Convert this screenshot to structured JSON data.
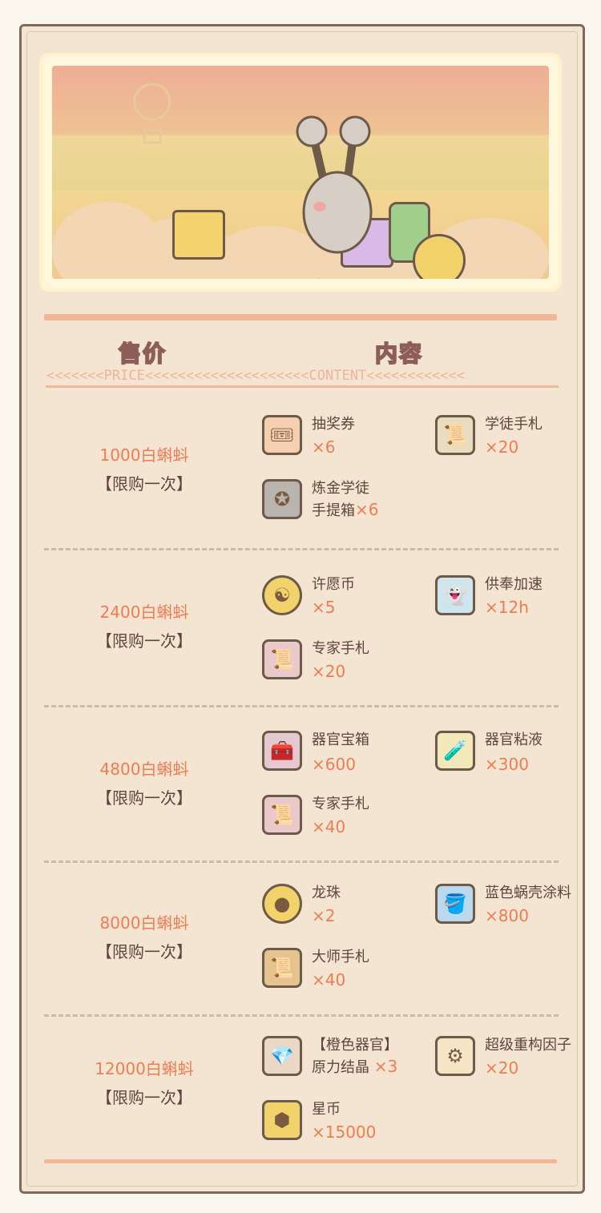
{
  "headers": {
    "price": "售价",
    "content": "内容"
  },
  "divider": {
    "left": "<<<<<<<PRICE",
    "mid": "<<<<<<<<<<<<<<<<<<<<CONTENT",
    "right": "<<<<<<<<<<<<"
  },
  "tiers": [
    {
      "price": "1000白蝌蚪",
      "limit": "【限购一次】",
      "items": [
        {
          "icon": "ticket-icon",
          "name": "抽奖券",
          "qty": "×6"
        },
        {
          "icon": "scroll-icon",
          "name": "学徒手札",
          "qty": "×20"
        },
        {
          "icon": "briefcase-icon",
          "name": "炼金学徒",
          "name2": "手提箱",
          "qty": "×6"
        }
      ]
    },
    {
      "price": "2400白蝌蚪",
      "limit": "【限购一次】",
      "items": [
        {
          "icon": "coin-icon",
          "name": "许愿币",
          "qty": "×5"
        },
        {
          "icon": "ghost-icon",
          "name": "供奉加速",
          "qty": "×12h"
        },
        {
          "icon": "expert-scroll-icon",
          "name": "专家手札",
          "qty": "×20"
        }
      ]
    },
    {
      "price": "4800白蝌蚪",
      "limit": "【限购一次】",
      "items": [
        {
          "icon": "chest-icon",
          "name": "器官宝箱",
          "qty": "×600"
        },
        {
          "icon": "vial-icon",
          "name": "器官粘液",
          "qty": "×300"
        },
        {
          "icon": "expert-scroll-icon",
          "name": "专家手札",
          "qty": "×40"
        }
      ]
    },
    {
      "price": "8000白蝌蚪",
      "limit": "【限购一次】",
      "items": [
        {
          "icon": "dragon-pearl-icon",
          "name": "龙珠",
          "qty": "×2"
        },
        {
          "icon": "paint-bucket-icon",
          "name": "蓝色蜗壳涂料",
          "qty": "×800"
        },
        {
          "icon": "master-scroll-icon",
          "name": "大师手札",
          "qty": "×40"
        }
      ]
    },
    {
      "price": "12000白蝌蚪",
      "limit": "【限购一次】",
      "items": [
        {
          "icon": "crystal-icon",
          "name": "【橙色器官】",
          "name2": "原力结晶",
          "qty": "×3"
        },
        {
          "icon": "factor-icon",
          "name": "超级重构因子",
          "qty": "×20"
        },
        {
          "icon": "star-coin-icon",
          "name": "星币",
          "qty": "×15000"
        }
      ]
    }
  ]
}
